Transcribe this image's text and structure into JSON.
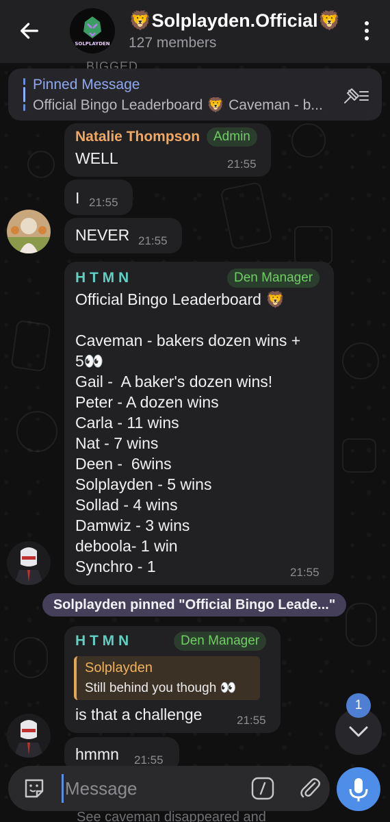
{
  "header": {
    "title": "🦁Solplayden.Official🦁",
    "members": "127 members",
    "avatar_text": "SOLPLAYDEN"
  },
  "peek_top": "BIGGED",
  "pinned": {
    "title": "Pinned Message",
    "text": "Official Bingo Leaderboard 🦁  Caveman - b..."
  },
  "messages": [
    {
      "sender": "Natalie Thompson",
      "role": "Admin",
      "text": "WELL",
      "time": "21:55"
    },
    {
      "text": "I",
      "time": "21:55"
    },
    {
      "text": "NEVER",
      "time": "21:55"
    },
    {
      "sender": "H T M N",
      "role": "Den Manager",
      "text": "Official Bingo Leaderboard 🦁\n\nCaveman - bakers dozen wins +\n5👀\nGail -  A baker's dozen wins!\nPeter - A dozen wins\nCarla - 11 wins\nNat - 7 wins\nDeen -  6wins\nSolplayden - 5 wins\nSollad - 4 wins\nDamwiz - 3 wins\ndeboola- 1 win\nSynchro - 1",
      "time": "21:55"
    },
    {
      "sender": "H T M N",
      "role": "Den Manager",
      "reply_name": "Solplayden",
      "reply_text": "Still behind you though 👀",
      "text": "is that a challenge",
      "time": "21:55"
    },
    {
      "text": "hmmn",
      "time": "21:55"
    }
  ],
  "service_message": "Solplayden pinned \"Official Bingo Leade...\"",
  "unread_count": "1",
  "input": {
    "placeholder": "Message"
  },
  "peek_bottom": "See caveman disappeared and",
  "colors": {
    "header_bg": "#212124",
    "bubble_bg": "#212124",
    "natalie_name": "#f0a862",
    "htmn_name": "#5fd0c2",
    "role_badge": "#6fcf65",
    "accent": "#4f8ee8"
  },
  "icons": [
    "back-arrow-icon",
    "more-vertical-icon",
    "unpin-icon",
    "sticker-icon",
    "command-icon",
    "attach-icon",
    "mic-icon",
    "chevron-down-icon"
  ]
}
